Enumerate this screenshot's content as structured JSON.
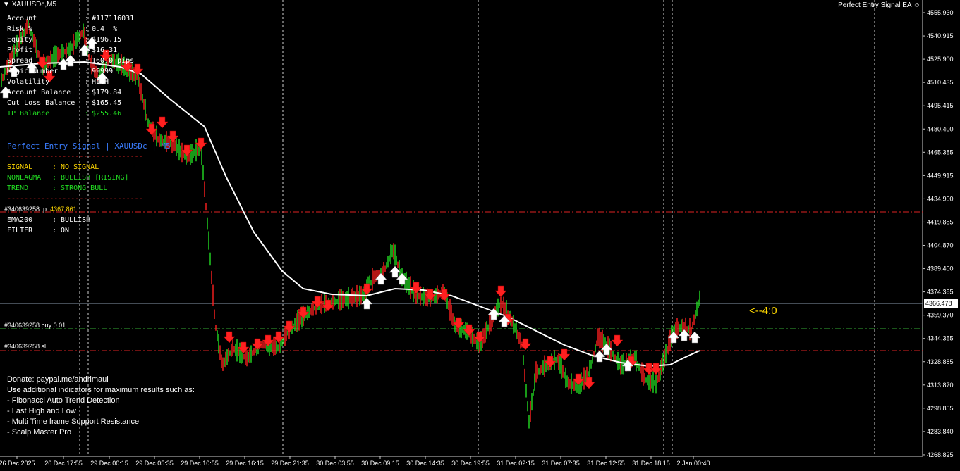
{
  "window": {
    "symbol": "XAUUSDc,M5",
    "ea_name": "Perfect Entry Signal EA ☺"
  },
  "account_info": [
    {
      "label": "Account",
      "value": "#117116031",
      "color": "#ffffff"
    },
    {
      "label": "Risk %",
      "value": "0.4  %",
      "color": "#ffffff"
    },
    {
      "label": "Equity",
      "value": "$196.15",
      "color": "#ffffff"
    },
    {
      "label": "Profit",
      "value": "$16.31",
      "color": "#ffffff"
    },
    {
      "label": "Spread",
      "value": "160.0 pips",
      "color": "#ffffff"
    },
    {
      "label": "Magic Number",
      "value": "99999",
      "color": "#ffffff"
    },
    {
      "label": "Volatility",
      "value": "HIGH",
      "color": "#ffffff"
    },
    {
      "label": "Account Balance",
      "value": "$179.84",
      "color": "#ffffff"
    },
    {
      "label": "Cut Loss Balance",
      "value": "$165.45",
      "color": "#ffffff"
    },
    {
      "label": "TP Balance",
      "value": "$255.46",
      "color": "#22dd22"
    }
  ],
  "signal_panel": {
    "title": "Perfect Entry Signal | XAUUSDc | M5",
    "divider": "--------------------------------",
    "rows": [
      {
        "label": "SIGNAL",
        "value": "NO SIGNAL",
        "color": "#ffd800"
      },
      {
        "label": "NONLAGMA",
        "value": "BULLISH [RISING]",
        "color": "#22dd22"
      },
      {
        "label": "TREND",
        "value": "STRONG BULL",
        "color": "#22dd22"
      }
    ],
    "rows2": [
      {
        "label": "EMA200",
        "value": "BULLISH",
        "color": "#ffffff"
      },
      {
        "label": "FILTER",
        "value": "ON",
        "color": "#ffffff"
      }
    ]
  },
  "order_labels": {
    "tp": "#340639258 tp",
    "tp_value": "4367.861",
    "buy": "#340639258 buy 0.01",
    "sl": "#340639258 sl"
  },
  "ratio_label": "<--4:0",
  "donate": [
    "Donate: paypal.me/andrimaul",
    "Use additional indicators for maximum results such as:",
    "- Fibonacci Auto Trend Detection",
    "- Last High and Low",
    "- Multi Time frame Support Resistance",
    "- Scalp Master Pro"
  ],
  "price_axis": [
    "4555.930",
    "4540.915",
    "4525.900",
    "4510.435",
    "4495.415",
    "4480.400",
    "4465.385",
    "4449.915",
    "4434.900",
    "4419.885",
    "4404.870",
    "4389.400",
    "4374.385",
    "4359.370",
    "4344.355",
    "4328.885",
    "4313.870",
    "4298.855",
    "4283.840",
    "4268.825"
  ],
  "current_price": "4366.478",
  "time_axis": [
    "26 Dec 2025",
    "26 Dec 17:55",
    "29 Dec 00:15",
    "29 Dec 05:35",
    "29 Dec 10:55",
    "29 Dec 16:15",
    "29 Dec 21:35",
    "30 Dec 03:55",
    "30 Dec 09:15",
    "30 Dec 14:35",
    "30 Dec 19:55",
    "31 Dec 02:15",
    "31 Dec 07:35",
    "31 Dec 12:55",
    "31 Dec 18:15",
    "2 Jan 00:40"
  ],
  "colors": {
    "bull": "#22dd22",
    "bear": "#ff2020",
    "ma": "#ffffff",
    "sl_line": "#d22",
    "buy_line": "#3a3",
    "text_yellow": "#ffd800"
  }
}
